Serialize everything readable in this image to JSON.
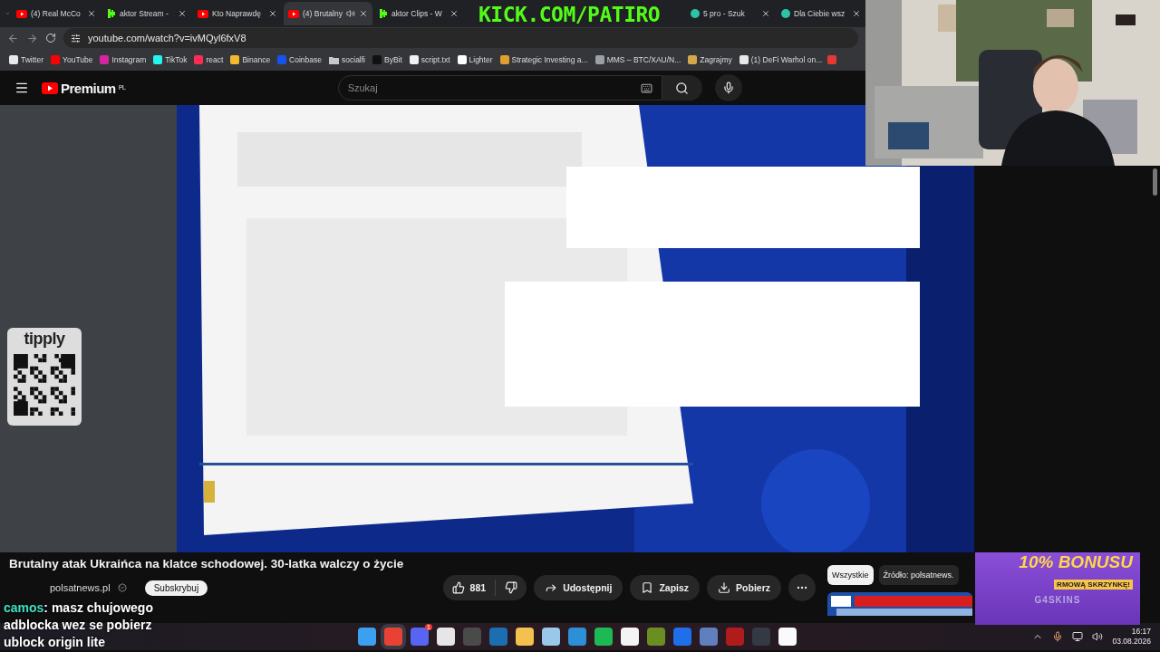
{
  "browser": {
    "tabs": [
      {
        "title": "(4) Real McCo",
        "kind": "youtube",
        "selected": false,
        "audio": false
      },
      {
        "title": "aktor Stream -",
        "kind": "kick",
        "selected": false,
        "audio": false
      },
      {
        "title": "Kto Naprawdę",
        "kind": "youtube",
        "selected": false,
        "audio": false
      },
      {
        "title": "(4) Brutalny",
        "kind": "youtube",
        "selected": true,
        "audio": true
      },
      {
        "title": "aktor Clips - W",
        "kind": "kick",
        "selected": false,
        "audio": false
      },
      {
        "title": "5 pro - Szuk",
        "kind": "other",
        "selected": false,
        "audio": false
      },
      {
        "title": "Dla Ciebie wsz",
        "kind": "other",
        "selected": false,
        "audio": false
      }
    ],
    "address": "youtube.com/watch?v=ivMQyl6fxV8",
    "bookmarks": [
      {
        "label": "Twitter",
        "kind": "site",
        "color": "#e8e8e8"
      },
      {
        "label": "YouTube",
        "kind": "site",
        "color": "#ff0000"
      },
      {
        "label": "Instagram",
        "kind": "site",
        "color": "#d6249f"
      },
      {
        "label": "TikTok",
        "kind": "site",
        "color": "#25f4ee"
      },
      {
        "label": "react",
        "kind": "site",
        "color": "#fe2c55"
      },
      {
        "label": "Binance",
        "kind": "site",
        "color": "#f3ba2f"
      },
      {
        "label": "Coinbase",
        "kind": "site",
        "color": "#1652f0"
      },
      {
        "label": "socialfi",
        "kind": "folder",
        "color": "#c8c8c8"
      },
      {
        "label": "ByBit",
        "kind": "site",
        "color": "#111111"
      },
      {
        "label": "script.txt",
        "kind": "site",
        "color": "#f0f0f0"
      },
      {
        "label": "Lighter",
        "kind": "site",
        "color": "#ffffff"
      },
      {
        "label": "Strategic Investing a...",
        "kind": "site",
        "color": "#e0a030"
      },
      {
        "label": "MMS – BTC/XAU/N...",
        "kind": "site",
        "color": "#9aa0a6"
      },
      {
        "label": "Zagrajmy",
        "kind": "site",
        "color": "#d4a84a"
      },
      {
        "label": "(1) DeFi Warhol on...",
        "kind": "site",
        "color": "#e8e8e8"
      }
    ]
  },
  "youtube": {
    "logo": "Premium",
    "region": "PL",
    "search_placeholder": "Szukaj",
    "title": "Brutalny atak Ukraińca na klatce schodowej. 30-latka walczy o życie",
    "channel": {
      "name": "polsatnews.pl",
      "verified": true
    },
    "subscribe": "Subskrybuj",
    "likes": "881",
    "actions": [
      "Udostępnij",
      "Zapisz",
      "Pobierz"
    ],
    "chips": [
      {
        "label": "Wszystkie",
        "selected": true
      },
      {
        "label": "Źródło: polsatnews.",
        "selected": false
      }
    ]
  },
  "overlays": {
    "kick": "KICK.COM/PATIRO",
    "tipply": "tipply",
    "chat": {
      "user": "camos",
      "message": ": masz chujowego adblocka wez se pobierz ublock origin lite"
    },
    "bonus": {
      "headline": "10% BONUSU",
      "tagline": "RMOWĄ SKRZYNKĘ!",
      "brand": "G4SKINS"
    }
  },
  "taskbar": {
    "apps": [
      {
        "color": "#3ca0f0",
        "active": false
      },
      {
        "color": "#e94235",
        "active": true
      },
      {
        "color": "#5865f2",
        "active": false,
        "badge": "1"
      },
      {
        "color": "#e6e6e6",
        "active": false
      },
      {
        "color": "#4a4a4a",
        "active": false
      },
      {
        "color": "#1b6fb0",
        "active": false
      },
      {
        "color": "#f2c14e",
        "active": false
      },
      {
        "color": "#9ac8e8",
        "active": false
      },
      {
        "color": "#2d8fd5",
        "active": false
      },
      {
        "color": "#1db954",
        "active": false
      },
      {
        "color": "#f4f4f4",
        "active": false
      },
      {
        "color": "#6b8e23",
        "active": false
      },
      {
        "color": "#1f6feb",
        "active": false
      },
      {
        "color": "#5f7fbf",
        "active": false
      },
      {
        "color": "#b01c1c",
        "active": false
      },
      {
        "color": "#333a44",
        "active": false
      },
      {
        "color": "#fafafa",
        "active": false
      }
    ],
    "time": "16:17",
    "date": "03.08.2026"
  }
}
